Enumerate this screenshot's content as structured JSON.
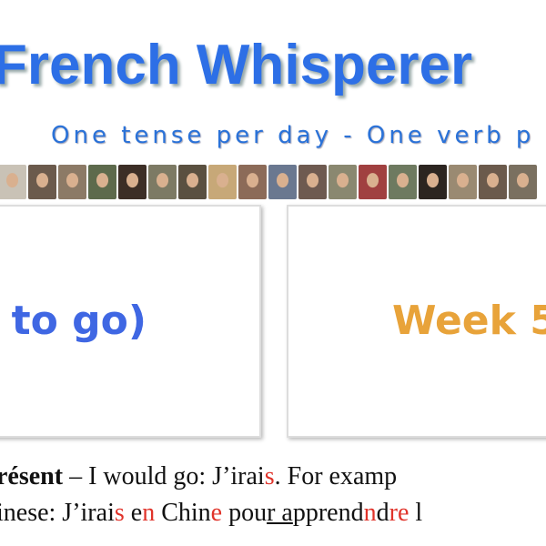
{
  "header": {
    "title": "French Whisperer",
    "subtitle": "One tense per day  -  One verb p"
  },
  "photo_strip": {
    "colors": [
      "#c9c2b6",
      "#6b5a4c",
      "#8c7a66",
      "#5d6a4c",
      "#3c2e26",
      "#7d7a64",
      "#5a5040",
      "#c7a878",
      "#8c6b58",
      "#6a7890",
      "#6e5a50",
      "#8a8870",
      "#a04040",
      "#6e7a60",
      "#2c2520",
      "#9a8a72",
      "#6b5a4c",
      "#7a7060"
    ]
  },
  "cards": {
    "left": "to go)",
    "right": "Week 5"
  },
  "body": {
    "line1": [
      {
        "t": "résent",
        "s": "b"
      },
      {
        "t": " – I would go: J’irai",
        "s": ""
      },
      {
        "t": "s",
        "s": "r"
      },
      {
        "t": ". For examp",
        "s": ""
      }
    ],
    "line2": [
      {
        "t": "inese: J’irai",
        "s": ""
      },
      {
        "t": "s",
        "s": "r"
      },
      {
        "t": " e",
        "s": ""
      },
      {
        "t": "n",
        "s": "r"
      },
      {
        "t": " Chin",
        "s": ""
      },
      {
        "t": "e",
        "s": "r"
      },
      {
        "t": " pou",
        "s": ""
      },
      {
        "t": "r a",
        "s": "u"
      },
      {
        "t": "pprend",
        "s": ""
      },
      {
        "t": "n",
        "s": "r"
      },
      {
        "t": "d",
        "s": ""
      },
      {
        "t": "re",
        "s": "r"
      },
      {
        "t": " l",
        "s": ""
      }
    ]
  }
}
